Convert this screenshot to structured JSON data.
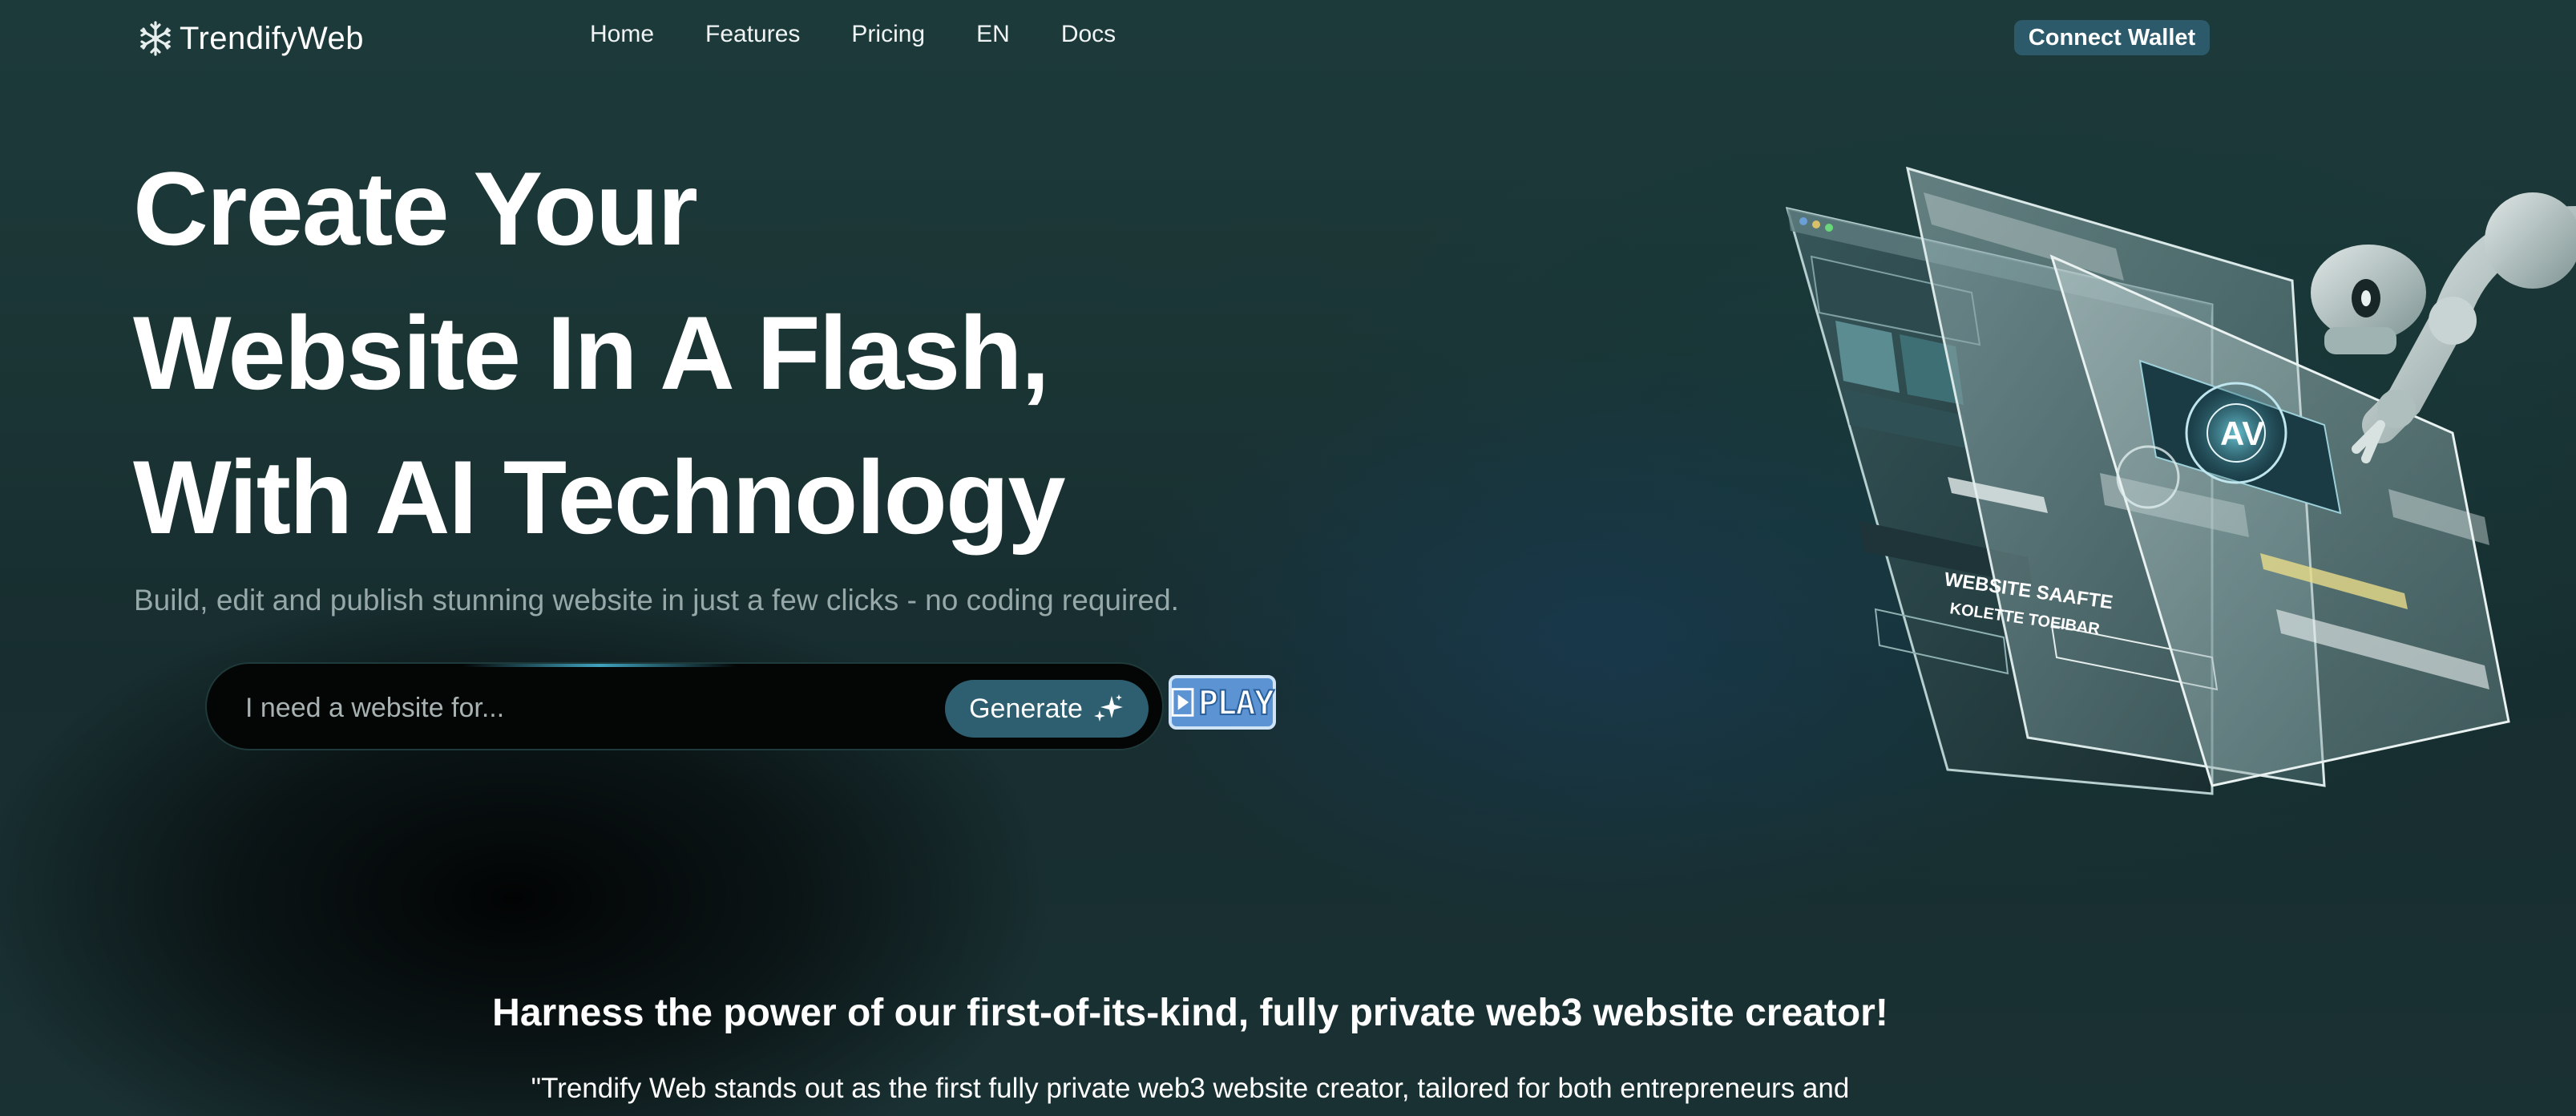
{
  "brand": {
    "name": "TrendifyWeb",
    "logo_icon": "snowflake-icon"
  },
  "nav": {
    "links": [
      {
        "label": "Home"
      },
      {
        "label": "Features"
      },
      {
        "label": "Pricing"
      },
      {
        "label": "EN"
      },
      {
        "label": "Docs"
      }
    ],
    "connect_wallet_label": "Connect Wallet"
  },
  "hero": {
    "title_lines": [
      "Create Your",
      "Website In A Flash,",
      "With AI Technology"
    ],
    "subtitle": "Build, edit and publish stunning website in just a few clicks - no coding required.",
    "prompt": {
      "placeholder": "I need a website for...",
      "value": ""
    },
    "generate_label": "Generate",
    "generate_icon": "sparkle-icon",
    "play_label": "PLAY",
    "play_icon": "play-triangle-icon",
    "art_labels": [
      "WEBSITE SAAFTE",
      "KOLETTE TOEIBAR",
      "AV"
    ]
  },
  "section": {
    "heading": "Harness the power of our first-of-its-kind, fully private web3 website creator!",
    "quote_line": "\"Trendify Web stands out as the first fully private web3 website creator, tailored for both entrepreneurs and"
  },
  "colors": {
    "background": "#1b3535",
    "accent_button": "#2d5a6a",
    "play_blue": "#5b93d3",
    "subtitle_gray": "#97a8a8"
  }
}
